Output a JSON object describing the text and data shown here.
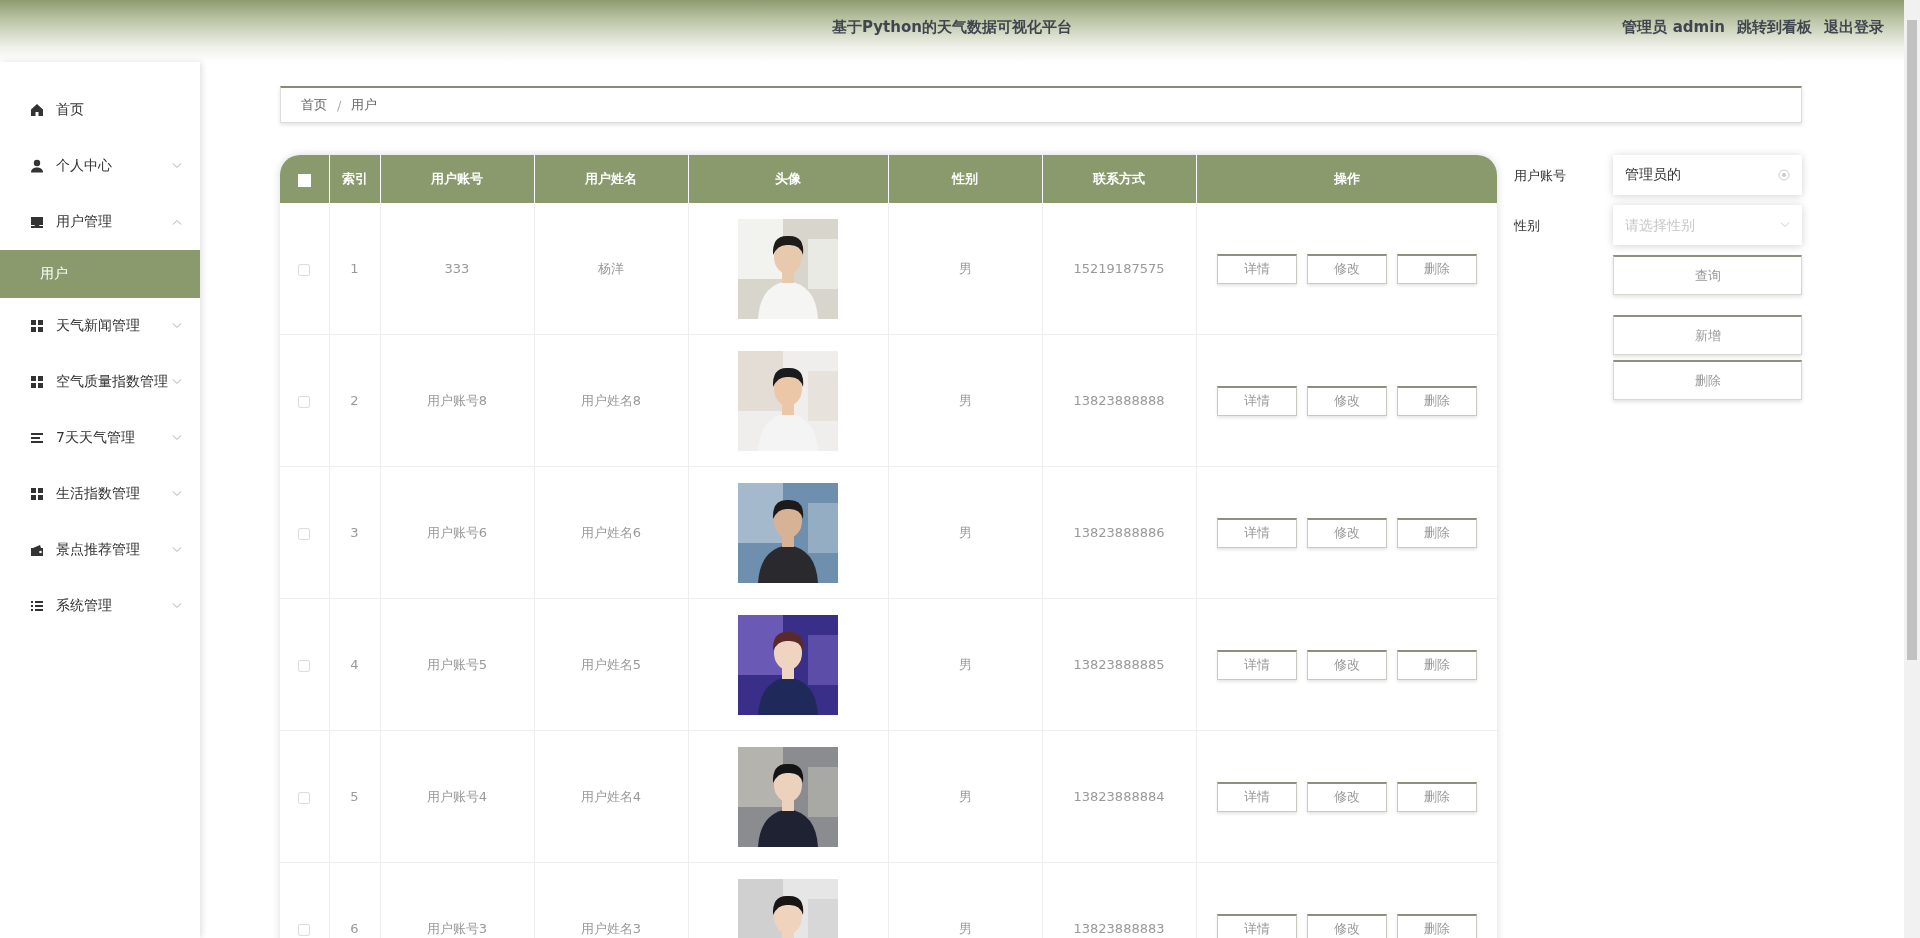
{
  "header": {
    "title": "基于Python的天气数据可视化平台",
    "user": "管理员 admin",
    "links": [
      "跳转到看板",
      "退出登录"
    ]
  },
  "sidebar": {
    "items": [
      {
        "label": "首页",
        "kind": "link"
      },
      {
        "label": "个人中心",
        "kind": "group",
        "expanded": false
      },
      {
        "label": "用户管理",
        "kind": "group",
        "expanded": true,
        "children": [
          {
            "label": "用户",
            "selected": true
          }
        ]
      },
      {
        "label": "天气新闻管理",
        "kind": "group",
        "expanded": false
      },
      {
        "label": "空气质量指数管理",
        "kind": "group",
        "expanded": false
      },
      {
        "label": "7天天气管理",
        "kind": "group",
        "expanded": false
      },
      {
        "label": "生活指数管理",
        "kind": "group",
        "expanded": false
      },
      {
        "label": "景点推荐管理",
        "kind": "group",
        "expanded": false
      },
      {
        "label": "系统管理",
        "kind": "group",
        "expanded": false
      }
    ]
  },
  "breadcrumb": {
    "items": [
      "首页",
      "用户"
    ],
    "separator": "/"
  },
  "table": {
    "select_all_checked": false,
    "columns": [
      "索引",
      "用户账号",
      "用户姓名",
      "头像",
      "性别",
      "联系方式",
      "操作"
    ],
    "rows": [
      {
        "checked": false,
        "index": "1",
        "account": "333",
        "name": "杨洋",
        "gender": "男",
        "contact": "15219187575",
        "actions": [
          "详情",
          "修改",
          "删除"
        ]
      },
      {
        "checked": false,
        "index": "2",
        "account": "用户账号8",
        "name": "用户姓名8",
        "gender": "男",
        "contact": "13823888888",
        "actions": [
          "详情",
          "修改",
          "删除"
        ]
      },
      {
        "checked": false,
        "index": "3",
        "account": "用户账号6",
        "name": "用户姓名6",
        "gender": "男",
        "contact": "13823888886",
        "actions": [
          "详情",
          "修改",
          "删除"
        ]
      },
      {
        "checked": false,
        "index": "4",
        "account": "用户账号5",
        "name": "用户姓名5",
        "gender": "男",
        "contact": "13823888885",
        "actions": [
          "详情",
          "修改",
          "删除"
        ]
      },
      {
        "checked": false,
        "index": "5",
        "account": "用户账号4",
        "name": "用户姓名4",
        "gender": "男",
        "contact": "13823888884",
        "actions": [
          "详情",
          "修改",
          "删除"
        ]
      },
      {
        "checked": false,
        "index": "6",
        "account": "用户账号3",
        "name": "用户姓名3",
        "gender": "男",
        "contact": "13823888883",
        "actions": [
          "详情",
          "修改",
          "删除"
        ]
      }
    ]
  },
  "search": {
    "fields": [
      {
        "label": "用户账号",
        "kind": "input",
        "value": "管理员的"
      },
      {
        "label": "性别",
        "kind": "select",
        "placeholder": "请选择性别"
      }
    ],
    "query_button": "查询",
    "buttons": [
      "新增",
      "删除"
    ]
  }
}
